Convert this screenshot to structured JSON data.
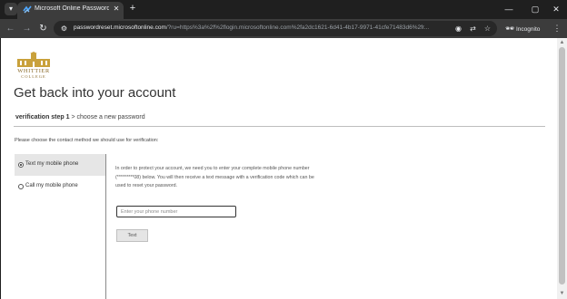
{
  "browser": {
    "tab_title": "Microsoft Online Password Res",
    "url_domain": "passwordreset.microsoftonline.com",
    "url_path": "/?ru=https%3a%2f%2flogin.microsoftonline.com%2fa2dc1621-6d41-4b17-9971-41cfe71483d6%2fr...",
    "incognito_label": "Incognito"
  },
  "page": {
    "logo": {
      "name": "WHITTIER",
      "subname": "COLLEGE"
    },
    "title": "Get back into your account",
    "steps": {
      "current": "verification step 1",
      "separator": " > ",
      "next": "choose a new password"
    },
    "instructions": "Please choose the contact method we should use for verification:",
    "methods": [
      {
        "label": "Text my mobile phone",
        "selected": true
      },
      {
        "label": "Call my mobile phone",
        "selected": false
      }
    ],
    "detail_text": "In order to protect your account, we need you to enter your complete mobile phone number (*********08) below. You will then receive a text message with a verification code which can be used to reset your password.",
    "phone_placeholder": "Enter your phone number",
    "phone_value": "",
    "text_button": "Text",
    "colors": {
      "logo_gold": "#c9a13b",
      "logo_text": "#8a6a2a",
      "selected_method_bg": "#e6e6e6"
    }
  }
}
